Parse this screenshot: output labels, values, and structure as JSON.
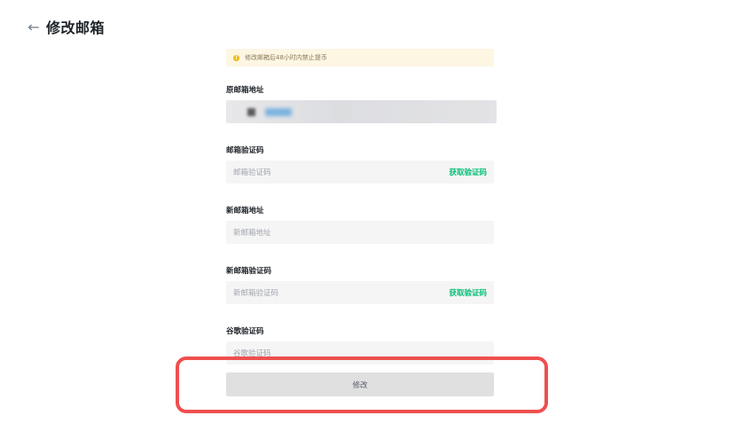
{
  "header": {
    "back_icon": "arrow-left-icon",
    "title": "修改邮箱"
  },
  "notice": {
    "icon": "warning-icon",
    "text": "修改邮箱后48小时内禁止提币"
  },
  "fields": {
    "original_email": {
      "label": "原邮箱地址"
    },
    "email_code": {
      "label": "邮箱验证码",
      "placeholder": "邮箱验证码",
      "action": "获取验证码"
    },
    "new_email": {
      "label": "新邮箱地址",
      "placeholder": "新邮箱地址"
    },
    "new_email_code": {
      "label": "新邮箱验证码",
      "placeholder": "新邮箱验证码",
      "action": "获取验证码"
    },
    "google_code": {
      "label": "谷歌验证码",
      "placeholder": "谷歌验证码"
    }
  },
  "submit": {
    "label": "修改"
  },
  "colors": {
    "accent_green": "#02c076",
    "notice_bg": "#fdf6e3",
    "highlight_red": "#ef4f4f"
  }
}
